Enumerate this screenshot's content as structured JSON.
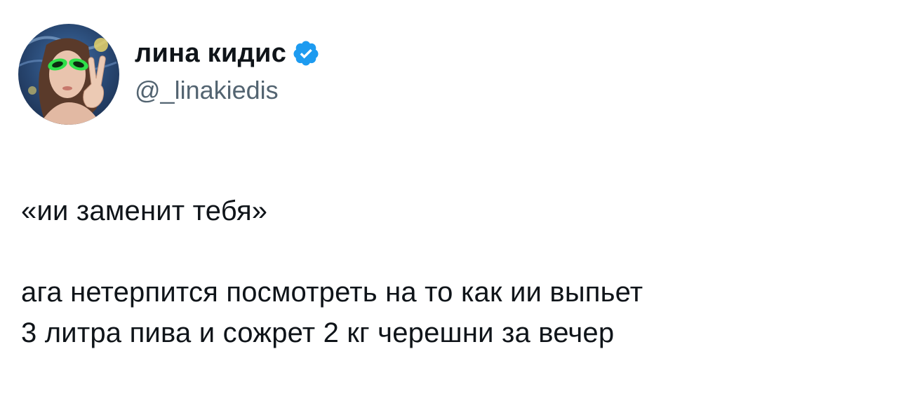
{
  "author": {
    "display_name": "лина кидис",
    "handle": "@_linakiedis",
    "verified": true,
    "verified_color": "#1d9bf0"
  },
  "tweet": {
    "line1": "«ии заменит тебя»",
    "line2": "ага нетерпится посмотреть на то как ии выпьет",
    "line3": "3 литра пива и сожрет 2 кг черешни за вечер"
  },
  "icons": {
    "verified": "verified-check-icon",
    "avatar": "profile-photo"
  }
}
